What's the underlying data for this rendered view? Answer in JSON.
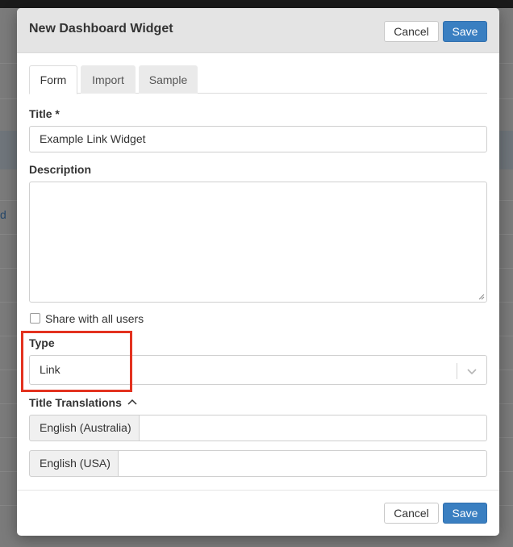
{
  "modal": {
    "title": "New Dashboard Widget",
    "cancel_label": "Cancel",
    "save_label": "Save"
  },
  "tabs": [
    {
      "label": "Form",
      "active": true
    },
    {
      "label": "Import",
      "active": false
    },
    {
      "label": "Sample",
      "active": false
    }
  ],
  "form": {
    "title_label": "Title *",
    "title_value": "Example Link Widget",
    "description_label": "Description",
    "description_value": "",
    "share_label": "Share with all users",
    "share_checked": false,
    "type_label": "Type",
    "type_value": "Link",
    "translations_label": "Title Translations",
    "translations": [
      {
        "language": "English (Australia)",
        "value": ""
      },
      {
        "language": "English (USA)",
        "value": ""
      }
    ]
  },
  "footer": {
    "cancel_label": "Cancel",
    "save_label": "Save"
  },
  "background": {
    "link_fragment": "d"
  },
  "colors": {
    "primary": "#3a7fc1",
    "highlight": "#e3321f"
  }
}
